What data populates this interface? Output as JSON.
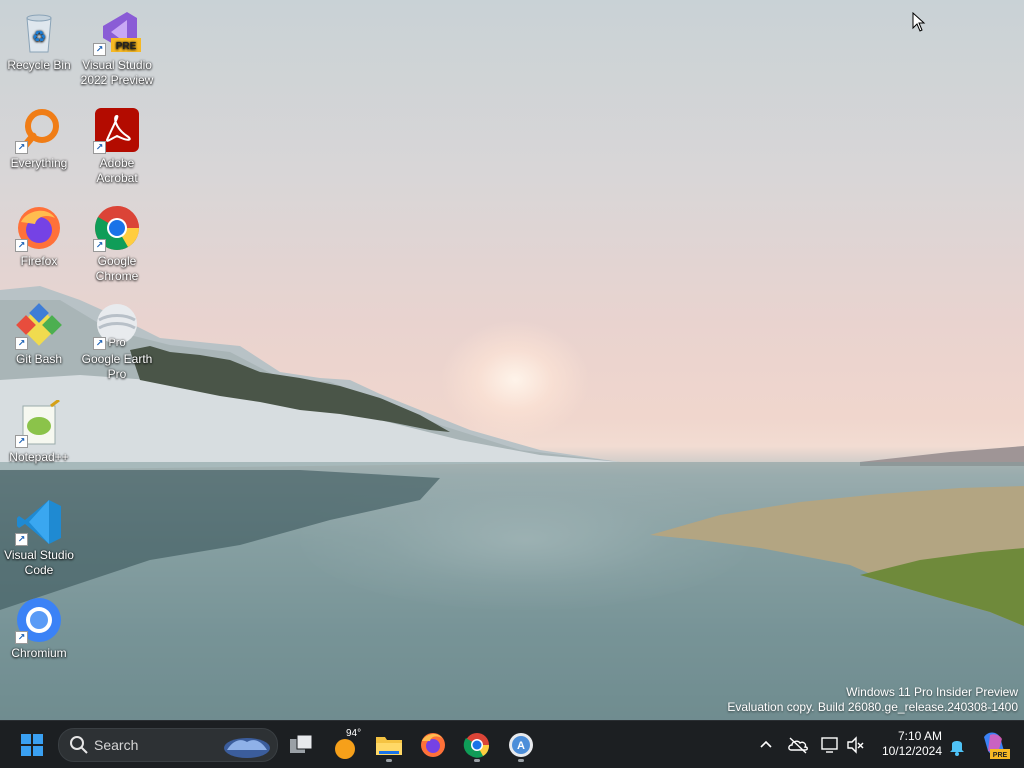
{
  "desktop": {
    "icons": [
      {
        "name": "Recycle Bin",
        "icon": "recycle-bin-icon",
        "shortcut": false
      },
      {
        "name": "Visual Studio 2022 Preview",
        "icon": "visual-studio-preview-icon",
        "shortcut": true,
        "badge": "PRE"
      },
      {
        "name": "Everything",
        "icon": "everything-search-icon",
        "shortcut": true
      },
      {
        "name": "Adobe Acrobat",
        "icon": "adobe-acrobat-icon",
        "shortcut": true
      },
      {
        "name": "Firefox",
        "icon": "firefox-icon",
        "shortcut": true
      },
      {
        "name": "Google Chrome",
        "icon": "chrome-icon",
        "shortcut": true
      },
      {
        "name": "Git Bash",
        "icon": "git-bash-icon",
        "shortcut": true
      },
      {
        "name": "Google Earth Pro",
        "icon": "google-earth-pro-icon",
        "shortcut": true,
        "badge": "Pro"
      },
      {
        "name": "Notepad++",
        "icon": "notepad-plus-plus-icon",
        "shortcut": true
      },
      {
        "name": "Visual Studio Code",
        "icon": "vscode-icon",
        "shortcut": true
      },
      {
        "name": "Chromium",
        "icon": "chromium-icon",
        "shortcut": true
      }
    ]
  },
  "watermark": {
    "line1": "Windows 11 Pro Insider Preview",
    "line2": "Evaluation copy. Build 26080.ge_release.240308-1400"
  },
  "taskbar": {
    "search_placeholder": "Search",
    "weather_temp": "94°",
    "apps": [
      "start-icon",
      "task-view-icon",
      "weather-icon",
      "file-explorer-icon",
      "firefox-icon",
      "chrome-icon",
      "app-store-icon"
    ],
    "tray": {
      "time": "7:10 AM",
      "date": "10/12/2024",
      "icons": [
        "chevron-up-icon",
        "onedrive-icon",
        "network-icon",
        "volume-muted-icon",
        "notification-bell-icon",
        "copilot-icon"
      ],
      "copilot_badge": "PRE"
    }
  },
  "colors": {
    "taskbar_bg": "#1c1f22",
    "accent": "#0078d4"
  }
}
